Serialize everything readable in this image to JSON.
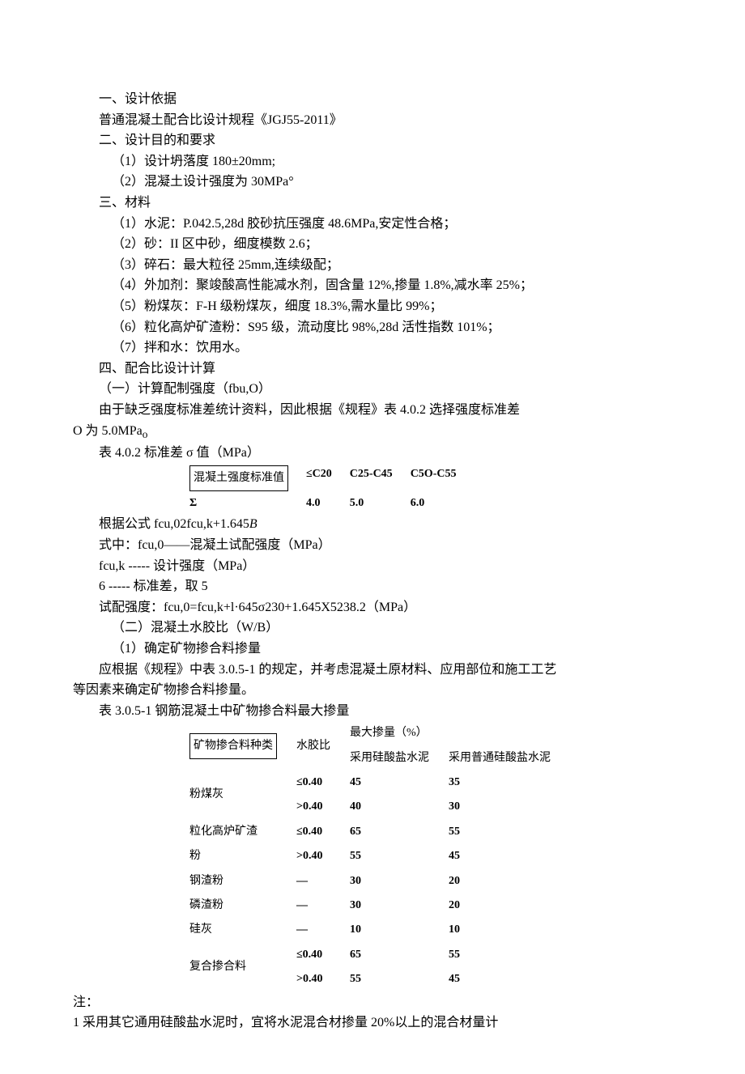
{
  "p1": "一、设计依据",
  "p2": "普通混凝土配合比设计规程《JGJ55-2011》",
  "p3": "二、设计目的和要求",
  "p4": "（1）设计坍落度 180±20mm;",
  "p5": "（2）混凝土设计强度为 30MPa°",
  "p6": "三、材料",
  "p7": "（1）水泥：P.042.5,28d 胶砂抗压强度 48.6MPa,安定性合格；",
  "p8": "（2）砂：II 区中砂，细度模数 2.6；",
  "p9": "（3）碎石：最大粒径 25mm,连续级配；",
  "p10": "（4）外加剂：聚竣酸高性能减水剂，固含量 12%,掺量 1.8%,减水率 25%；",
  "p11": "（5）粉煤灰：F-H 级粉煤灰，细度 18.3%,需水量比 99%；",
  "p12": "（6）粒化高炉矿渣粉：S95 级，流动度比 98%,28d 活性指数 101%；",
  "p13": "（7）拌和水：饮用水。",
  "p14": "四、配合比设计计算",
  "p15": "（一）计算配制强度（fbu,O）",
  "p16a": "由于缺乏强度标准差统计资料，因此根据《规程》表 4.0.2 选择强度标准差",
  "p16b": "O 为 5.0MPa",
  "p16c": "o",
  "p17": "表 4.0.2 标准差 σ 值（MPa）",
  "t1": {
    "h1": "混凝土强度标准值",
    "h2": "≤C20",
    "h3": "C25-C45",
    "h4": "C5O-C55",
    "r1": "Σ",
    "r2": "4.0",
    "r3": "5.0",
    "r4": "6.0"
  },
  "p18a": "根据公式 fcu,02fcu,k+1.645",
  "p18b": "B",
  "p19": "式中：fcu,0——混凝土试配强度（MPa）",
  "p20": "fcu,k ----- 设计强度（MPa）",
  "p21": "6 ----- 标准差，取 5",
  "p22": "试配强度：fcu,0=fcu,k+l·645σ230+1.645X5238.2（MPa）",
  "p23": "（二）混凝土水胶比（W/B）",
  "p24": "（1）确定矿物掺合料掺量",
  "p25a": "应根据《规程》中表 3.0.5-1 的规定，并考虑混凝土原材料、应用部位和施工工艺",
  "p25b": "等因素来确定矿物掺合料掺量。",
  "p26": "表 3.0.5-1 钢筋混凝土中矿物掺合料最大掺量",
  "t2": {
    "h1": "矿物掺合料种类",
    "h2": "水胶比",
    "h3a": "最大掺量（%）",
    "h3b": "采用硅酸盐水泥",
    "h3c": "采用普通硅酸盐水泥",
    "r": [
      [
        "粉煤灰",
        "≤0.40",
        "45",
        "35"
      ],
      [
        "",
        ">0.40",
        "40",
        "30"
      ],
      [
        "粒化高炉矿渣",
        "≤0.40",
        "65",
        "55"
      ],
      [
        "粉",
        ">0.40",
        "55",
        "45"
      ],
      [
        "钢渣粉",
        "—",
        "30",
        "20"
      ],
      [
        "磷渣粉",
        "—",
        "30",
        "20"
      ],
      [
        "硅灰",
        "—",
        "10",
        "10"
      ],
      [
        "复合掺合料",
        "≤0.40",
        "65",
        "55"
      ],
      [
        "",
        ">0.40",
        "55",
        "45"
      ]
    ]
  },
  "p27": "注：",
  "p28": "1 采用其它通用硅酸盐水泥时，宜将水泥混合材掺量 20%以上的混合材量计"
}
